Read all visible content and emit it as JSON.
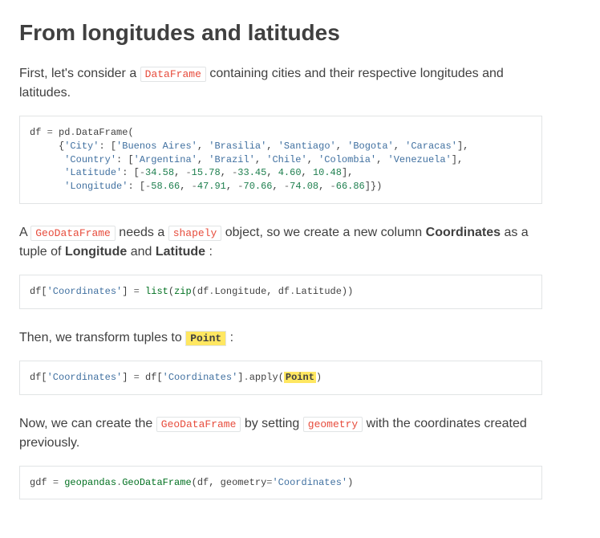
{
  "heading": "From longitudes and latitudes",
  "p1": {
    "pre": "First, let's consider a ",
    "lit": "DataFrame",
    "post": " containing cities and their respective longitudes and latitudes."
  },
  "code1": {
    "l1a": "df ",
    "l1b": "=",
    "l1c": " pd",
    "l1d": ".",
    "l1e": "DataFrame",
    "l1f": "(",
    "l2a": "     ",
    "l2b": "{",
    "l2c": "'City'",
    "l2d": ":",
    "l2e": " ",
    "l2f": "[",
    "l2g": "'Buenos Aires'",
    "l2h": ",",
    "l2i": " ",
    "l2j": "'Brasilia'",
    "l2k": ",",
    "l2l": " ",
    "l2m": "'Santiago'",
    "l2n": ",",
    "l2o": " ",
    "l2p": "'Bogota'",
    "l2q": ",",
    "l2r": " ",
    "l2s": "'Caracas'",
    "l2t": "],",
    "l3a": "      ",
    "l3b": "'Country'",
    "l3c": ":",
    "l3d": " ",
    "l3e": "[",
    "l3f": "'Argentina'",
    "l3g": ",",
    "l3h": " ",
    "l3i": "'Brazil'",
    "l3j": ",",
    "l3k": " ",
    "l3l": "'Chile'",
    "l3m": ",",
    "l3n": " ",
    "l3o": "'Colombia'",
    "l3p": ",",
    "l3q": " ",
    "l3r": "'Venezuela'",
    "l3s": "],",
    "l4a": "      ",
    "l4b": "'Latitude'",
    "l4c": ":",
    "l4d": " ",
    "l4e": "[",
    "l4f": "-",
    "l4g": "34.58",
    "l4h": ",",
    "l4i": " ",
    "l4j": "-",
    "l4k": "15.78",
    "l4l": ",",
    "l4m": " ",
    "l4n": "-",
    "l4o": "33.45",
    "l4p": ",",
    "l4q": " ",
    "l4r": "4.60",
    "l4s": ",",
    "l4t": " ",
    "l4u": "10.48",
    "l4v": "],",
    "l5a": "      ",
    "l5b": "'Longitude'",
    "l5c": ":",
    "l5d": " ",
    "l5e": "[",
    "l5f": "-",
    "l5g": "58.66",
    "l5h": ",",
    "l5i": " ",
    "l5j": "-",
    "l5k": "47.91",
    "l5l": ",",
    "l5m": " ",
    "l5n": "-",
    "l5o": "70.66",
    "l5p": ",",
    "l5q": " ",
    "l5r": "-",
    "l5s": "74.08",
    "l5t": ",",
    "l5u": " ",
    "l5v": "-",
    "l5w": "66.86",
    "l5x": "]})"
  },
  "p2": {
    "a": "A ",
    "lit1": "GeoDataFrame",
    "b": " needs a ",
    "lit2": "shapely",
    "c": " object, so we create a new column ",
    "strong1": "Coordinates",
    "d": " as a tuple of ",
    "strong2": "Longitude",
    "e": " and ",
    "strong3": "Latitude",
    "f": " :"
  },
  "code2": {
    "a": "df",
    "b": "[",
    "c": "'Coordinates'",
    "d": "]",
    "e": " ",
    "f": "=",
    "g": " ",
    "h": "list",
    "i": "(",
    "j": "zip",
    "k": "(",
    "l": "df",
    "m": ".",
    "n1": "Longitude",
    "o1": ",",
    "p1": " df",
    "q": ".",
    "r": "Latitude",
    "s": "))"
  },
  "p3": {
    "a": "Then, we transform tuples to ",
    "lit": "Point",
    "b": " :"
  },
  "code3": {
    "a": "df",
    "b": "[",
    "c": "'Coordinates'",
    "d": "]",
    "e": " ",
    "f": "=",
    "g": " df",
    "h": "[",
    "i": "'Coordinates'",
    "j": "]",
    "k": ".",
    "l": "apply",
    "m": "(",
    "hl": "Point",
    "o": ")"
  },
  "p4": {
    "a": "Now, we can create the ",
    "lit1": "GeoDataFrame",
    "b": " by setting ",
    "lit2": "geometry",
    "c": " with the coordinates created previously."
  },
  "code4": {
    "a": "gdf ",
    "b": "=",
    "c": " ",
    "d": "geopandas",
    "e": ".",
    "f": "GeoDataFrame",
    "g": "(",
    "h": "df",
    "i": ",",
    "j": " geometry",
    "k": "=",
    "l": "'Coordinates'",
    "m": ")"
  }
}
